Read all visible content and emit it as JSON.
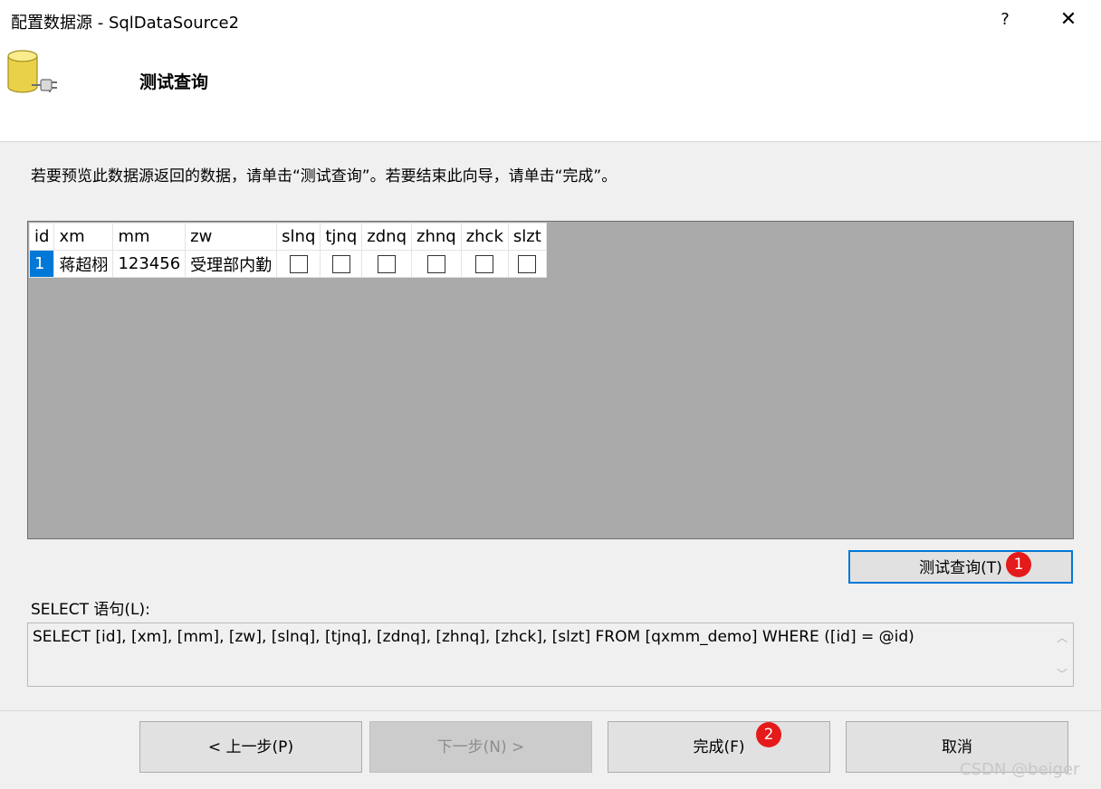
{
  "window": {
    "title": "配置数据源 - SqlDataSource2",
    "help_glyph": "?",
    "close_glyph": "✕"
  },
  "header": {
    "heading": "测试查询"
  },
  "instruction": "若要预览此数据源返回的数据，请单击“测试查询”。若要结束此向导，请单击“完成”。",
  "grid": {
    "columns": [
      "id",
      "xm",
      "mm",
      "zw",
      "slnq",
      "tjnq",
      "zdnq",
      "zhnq",
      "zhck",
      "slzt"
    ],
    "rows": [
      {
        "id": "1",
        "xm": "蒋超栩",
        "mm": "123456",
        "zw": "受理部内勤",
        "checks": [
          false,
          false,
          false,
          false,
          false,
          false
        ]
      }
    ]
  },
  "test_query_button": "测试查询(T)",
  "sql": {
    "label": "SELECT 语句(L):",
    "text": "SELECT [id], [xm], [mm], [zw], [slnq], [tjnq], [zdnq], [zhnq], [zhck], [slzt] FROM [qxmm_demo] WHERE ([id] = @id)",
    "scroll_up_glyph": "︿",
    "scroll_down_glyph": "﹀"
  },
  "footer": {
    "prev": "< 上一步(P)",
    "next": "下一步(N) >",
    "finish": "完成(F)",
    "cancel": "取消"
  },
  "badges": [
    "1",
    "2"
  ],
  "watermark": "CSDN @beiger",
  "colors": {
    "selection": "#0078d7",
    "badge": "#e51a1a",
    "grid_background": "#aaaaaa"
  },
  "icons": [
    "database-connection-icon",
    "help-icon",
    "close-icon",
    "scroll-up-icon",
    "scroll-down-icon"
  ]
}
